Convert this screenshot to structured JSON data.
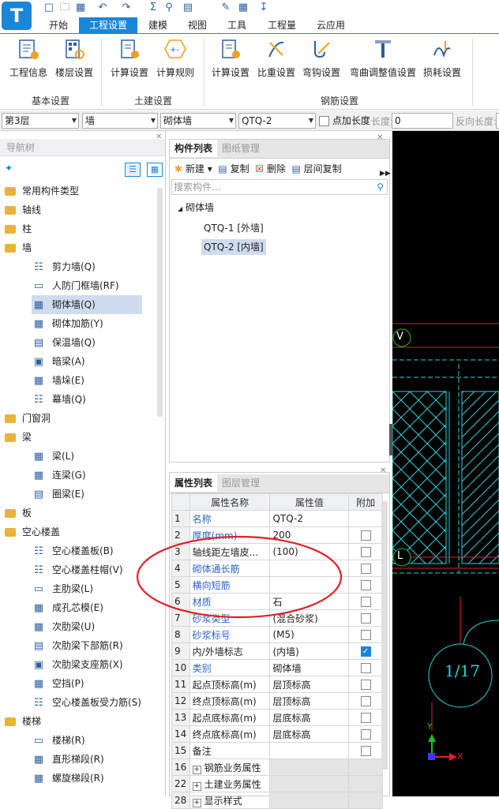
{
  "app": {
    "logo": "T"
  },
  "quick_access": [
    "new-file-icon",
    "open-folder-icon",
    "save-icon",
    "undo-icon",
    "redo-icon",
    "sum-icon",
    "find-icon",
    "report-icon",
    "pen-icon",
    "grid-icon",
    "download-icon"
  ],
  "menu": {
    "items": [
      "开始",
      "工程设置",
      "建模",
      "视图",
      "工具",
      "工程量",
      "云应用"
    ],
    "active": "工程设置"
  },
  "ribbon": {
    "groups": [
      {
        "label": "基本设置",
        "buttons": [
          "工程信息",
          "楼层设置"
        ]
      },
      {
        "label": "土建设置",
        "buttons": [
          "计算设置",
          "计算规则"
        ]
      },
      {
        "label": "钢筋设置",
        "buttons": [
          "计算设置",
          "比重设置",
          "弯钩设置",
          "弯曲调整值设置",
          "损耗设置"
        ]
      }
    ]
  },
  "filter": {
    "floor": "第3层",
    "type": "墙",
    "subtype": "砌体墙",
    "component": "QTQ-2",
    "point_length_label": "点加长度",
    "length_label": "长度:",
    "length_value": "0",
    "reverse_label": "反向长度:"
  },
  "nav": {
    "title": "导航树",
    "items": [
      {
        "label": "常用构件类型",
        "kind": "cat"
      },
      {
        "label": "轴线",
        "kind": "cat"
      },
      {
        "label": "柱",
        "kind": "cat"
      },
      {
        "label": "墙",
        "kind": "cat"
      },
      {
        "label": "剪力墙(Q)",
        "kind": "sub"
      },
      {
        "label": "人防门框墙(RF)",
        "kind": "sub"
      },
      {
        "label": "砌体墙(Q)",
        "kind": "sub",
        "selected": true
      },
      {
        "label": "砌体加筋(Y)",
        "kind": "sub"
      },
      {
        "label": "保温墙(Q)",
        "kind": "sub"
      },
      {
        "label": "暗梁(A)",
        "kind": "sub"
      },
      {
        "label": "墙垛(E)",
        "kind": "sub"
      },
      {
        "label": "幕墙(Q)",
        "kind": "sub"
      },
      {
        "label": "门窗洞",
        "kind": "cat"
      },
      {
        "label": "梁",
        "kind": "cat"
      },
      {
        "label": "梁(L)",
        "kind": "sub"
      },
      {
        "label": "连梁(G)",
        "kind": "sub"
      },
      {
        "label": "圈梁(E)",
        "kind": "sub"
      },
      {
        "label": "板",
        "kind": "cat"
      },
      {
        "label": "空心楼盖",
        "kind": "cat"
      },
      {
        "label": "空心楼盖板(B)",
        "kind": "sub"
      },
      {
        "label": "空心楼盖柱帽(V)",
        "kind": "sub"
      },
      {
        "label": "主肋梁(L)",
        "kind": "sub"
      },
      {
        "label": "成孔芯模(E)",
        "kind": "sub"
      },
      {
        "label": "次肋梁(U)",
        "kind": "sub"
      },
      {
        "label": "次肋梁下部筋(R)",
        "kind": "sub"
      },
      {
        "label": "次肋梁支座筋(X)",
        "kind": "sub"
      },
      {
        "label": "空挡(P)",
        "kind": "sub"
      },
      {
        "label": "空心楼盖板受力筋(S)",
        "kind": "sub"
      },
      {
        "label": "楼梯",
        "kind": "cat"
      },
      {
        "label": "楼梯(R)",
        "kind": "sub"
      },
      {
        "label": "直形梯段(R)",
        "kind": "sub"
      },
      {
        "label": "螺旋梯段(R)",
        "kind": "sub"
      }
    ]
  },
  "components": {
    "tabs": [
      "构件列表",
      "图纸管理"
    ],
    "toolbar": {
      "new": "新建",
      "copy": "复制",
      "delete": "删除",
      "floor_copy": "层间复制"
    },
    "search_placeholder": "搜索构件...",
    "group": "砌体墙",
    "items": [
      {
        "label": "QTQ-1 [外墙]",
        "selected": false
      },
      {
        "label": "QTQ-2 [内墙]",
        "selected": true
      }
    ]
  },
  "properties": {
    "tabs": [
      "属性列表",
      "图层管理"
    ],
    "headers": [
      "属性名称",
      "属性值",
      "附加"
    ],
    "rows": [
      {
        "n": "1",
        "name": "名称",
        "value": "QTQ-2",
        "blue": true,
        "cb": null
      },
      {
        "n": "2",
        "name": "厚度(mm)",
        "value": "200",
        "blue": true,
        "cb": false
      },
      {
        "n": "3",
        "name": "轴线距左墙皮...",
        "value": "(100)",
        "blue": false,
        "cb": false
      },
      {
        "n": "4",
        "name": "砌体通长筋",
        "value": "",
        "blue": true,
        "cb": false
      },
      {
        "n": "5",
        "name": "横向短筋",
        "value": "",
        "blue": true,
        "cb": false
      },
      {
        "n": "6",
        "name": "材质",
        "value": "石",
        "blue": true,
        "cb": false
      },
      {
        "n": "7",
        "name": "砂浆类型",
        "value": "(混合砂浆)",
        "blue": true,
        "cb": false
      },
      {
        "n": "8",
        "name": "砂浆标号",
        "value": "(M5)",
        "blue": true,
        "cb": false
      },
      {
        "n": "9",
        "name": "内/外墙标志",
        "value": "(内墙)",
        "blue": false,
        "cb": true
      },
      {
        "n": "10",
        "name": "类别",
        "value": "砌体墙",
        "blue": true,
        "cb": false
      },
      {
        "n": "11",
        "name": "起点顶标高(m)",
        "value": "层顶标高",
        "blue": false,
        "cb": false
      },
      {
        "n": "12",
        "name": "终点顶标高(m)",
        "value": "层顶标高",
        "blue": false,
        "cb": false
      },
      {
        "n": "13",
        "name": "起点底标高(m)",
        "value": "层底标高",
        "blue": false,
        "cb": false
      },
      {
        "n": "14",
        "name": "终点底标高(m)",
        "value": "层底标高",
        "blue": false,
        "cb": false
      },
      {
        "n": "15",
        "name": "备注",
        "value": "",
        "blue": false,
        "cb": false
      },
      {
        "n": "16",
        "name": "钢筋业务属性",
        "value": "",
        "blue": false,
        "cb": null,
        "expand": true
      },
      {
        "n": "22",
        "name": "土建业务属性",
        "value": "",
        "blue": false,
        "cb": null,
        "expand": true
      },
      {
        "n": "28",
        "name": "显示样式",
        "value": "",
        "blue": false,
        "cb": null,
        "expand": true
      }
    ]
  },
  "canvas": {
    "axis_v": "V",
    "axis_l": "L",
    "section_mark": "1/17",
    "axis_y": "Y",
    "axis_x": "X",
    "colors": {
      "red": "#e0202a",
      "cyan": "#2ed0d8",
      "green": "#21c021",
      "blue": "#3a3aff",
      "annotation": "#e0202a"
    }
  }
}
